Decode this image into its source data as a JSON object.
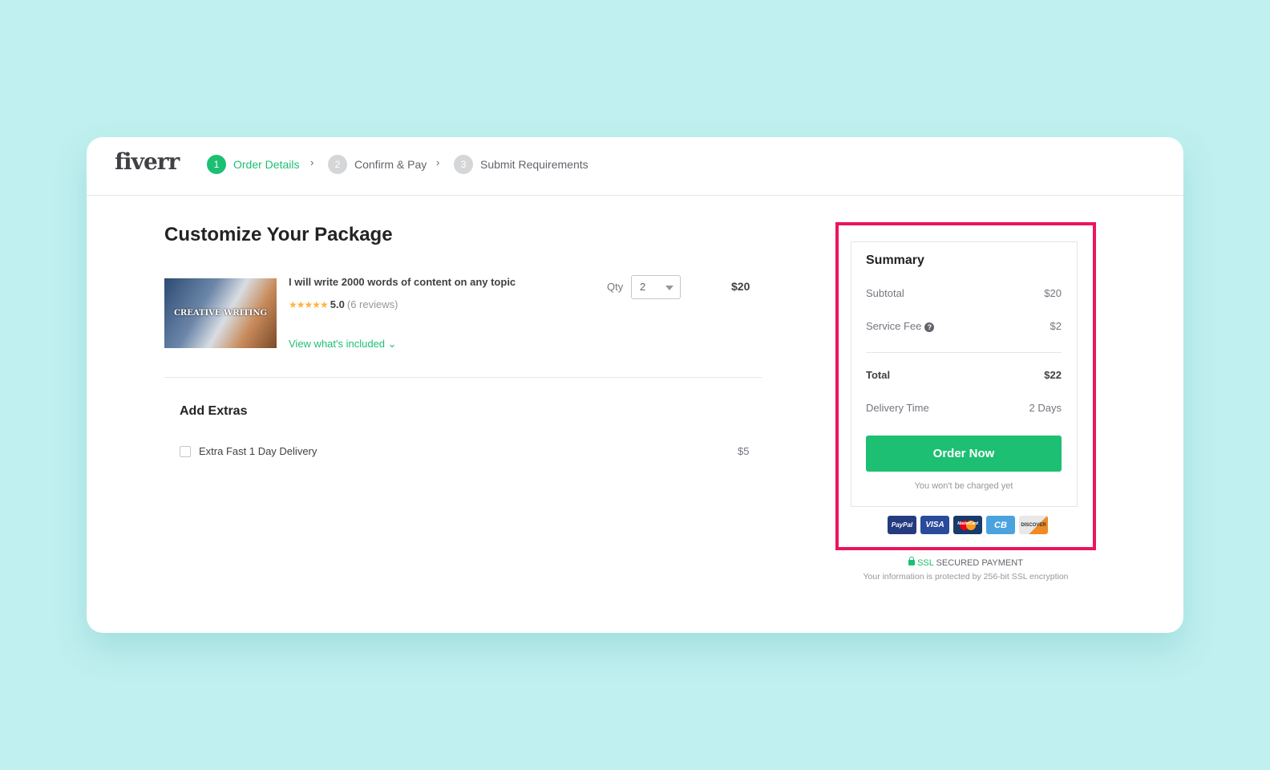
{
  "header": {
    "logo": "fiverr",
    "steps": [
      {
        "num": "1",
        "label": "Order Details"
      },
      {
        "num": "2",
        "label": "Confirm & Pay"
      },
      {
        "num": "3",
        "label": "Submit Requirements"
      }
    ],
    "separator": "›"
  },
  "main": {
    "title": "Customize Your Package",
    "gig": {
      "thumb_text": "CREATIVE WRITING",
      "title": "I will write 2000 words of content on any topic",
      "stars": "★★★★★",
      "rating": "5.0",
      "reviews": "(6 reviews)",
      "view_link": "View what's included ⌄",
      "qty_label": "Qty",
      "qty_value": "2",
      "price": "$20"
    },
    "extras": {
      "title": "Add Extras",
      "items": [
        {
          "label": "Extra Fast 1 Day Delivery",
          "price": "$5",
          "checked": false
        }
      ]
    }
  },
  "summary": {
    "title": "Summary",
    "subtotal_label": "Subtotal",
    "subtotal": "$20",
    "fee_label": "Service Fee",
    "fee_icon": "?",
    "fee": "$2",
    "total_label": "Total",
    "total": "$22",
    "delivery_label": "Delivery Time",
    "delivery": "2 Days",
    "order_button": "Order Now",
    "note": "You won't be charged yet",
    "highlight_color": "#ec155c",
    "payments": [
      {
        "label": "PayPal",
        "color": "#253b80"
      },
      {
        "label": "VISA",
        "color": "#2a4a9c"
      },
      {
        "label": "MasterCard",
        "color": "#1a3a6a"
      },
      {
        "label": "CB",
        "color": "#4aa3df"
      },
      {
        "label": "DISCOVER",
        "color": "#e8e8e8"
      }
    ],
    "ssl_label": "SSL",
    "ssl_text": "SECURED PAYMENT",
    "ssl_note": "Your information is protected by 256-bit SSL encryption"
  },
  "colors": {
    "accent": "#1dbf73",
    "background": "#c0f0f0"
  }
}
